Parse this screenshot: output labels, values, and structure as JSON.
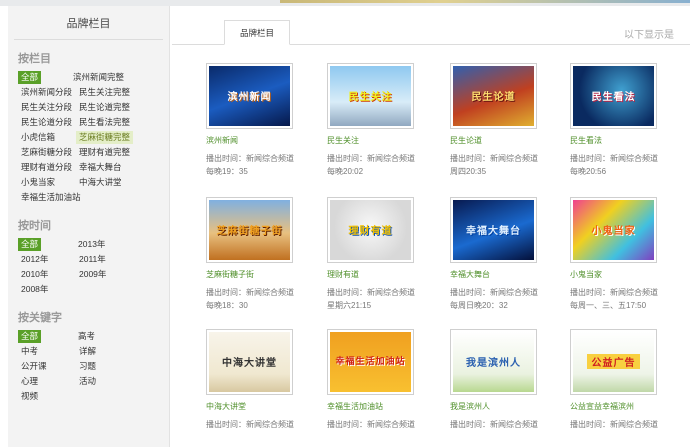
{
  "sidebar": {
    "title": "品牌栏目",
    "sections": [
      {
        "heading": "按栏目",
        "rows": [
          [
            "全部",
            "滨州新闻完整"
          ],
          [
            "滨州新闻分段",
            "民生关注完整"
          ],
          [
            "民生关注分段",
            "民生论道完整"
          ],
          [
            "民生论道分段",
            "民生看法完整"
          ],
          [
            "小虎信箱",
            "芝麻街糖完整"
          ],
          [
            "芝麻街糖分段",
            "理财有道完整"
          ],
          [
            "理财有道分段",
            "幸福大舞台"
          ],
          [
            "小鬼当家",
            "中海大讲堂"
          ],
          [
            "幸福生活加油站",
            ""
          ]
        ]
      },
      {
        "heading": "按时间",
        "rows": [
          [
            "全部",
            "2013年"
          ],
          [
            "2012年",
            "2011年"
          ],
          [
            "2010年",
            "2009年"
          ],
          [
            "2008年",
            ""
          ]
        ]
      },
      {
        "heading": "按关键字",
        "rows": [
          [
            "全部",
            "高考"
          ],
          [
            "中考",
            "详解"
          ],
          [
            "公开课",
            "习题"
          ],
          [
            "心理",
            "活动"
          ],
          [
            "视频",
            ""
          ]
        ]
      }
    ]
  },
  "tabs": {
    "active_label": "品牌栏目",
    "right_text": "以下显示是"
  },
  "programs": [
    {
      "thumb_text": "滨州新闻",
      "name": "滨州新闻",
      "info1": "播出时间：新闻综合频道",
      "info2": "每晚19：35"
    },
    {
      "thumb_text": "民生关注",
      "name": "民生关注",
      "info1": "播出时间：新闻综合频道",
      "info2": "每晚20:02"
    },
    {
      "thumb_text": "民生论道",
      "name": "民生论道",
      "info1": "播出时间：新闻综合频道",
      "info2": "周四20:35"
    },
    {
      "thumb_text": "民生看法",
      "name": "民生看法",
      "info1": "播出时间：新闻综合频道",
      "info2": "每晚20:56"
    },
    {
      "thumb_text": "芝麻街糖子街",
      "name": "芝麻街糖子街",
      "info1": "播出时间：新闻综合频道",
      "info2": "每晚18：30"
    },
    {
      "thumb_text": "理财有道",
      "name": "理财有道",
      "info1": "播出时间：新闻综合频道",
      "info2": "星期六21:15"
    },
    {
      "thumb_text": "幸福大舞台",
      "name": "幸福大舞台",
      "info1": "播出时间：新闻综合频道",
      "info2": "每周日晚20：32"
    },
    {
      "thumb_text": "小鬼当家",
      "name": "小鬼当家",
      "info1": "播出时间：新闻综合频道",
      "info2": "每周一、三、五17:50"
    },
    {
      "thumb_text": "中海大讲堂",
      "name": "中海大讲堂",
      "info1": "播出时间：新闻综合频道",
      "info2": ""
    },
    {
      "thumb_text": "幸福生活加油站",
      "name": "幸福生活加油站",
      "info1": "播出时间：新闻综合频道",
      "info2": ""
    },
    {
      "thumb_text": "我是滨州人",
      "name": "我是滨州人",
      "info1": "播出时间：新闻综合频道",
      "info2": ""
    },
    {
      "thumb_text": "公益广告",
      "name": "公益宣益幸福滨州",
      "info1": "播出时间：新闻综合频道",
      "info2": ""
    }
  ]
}
